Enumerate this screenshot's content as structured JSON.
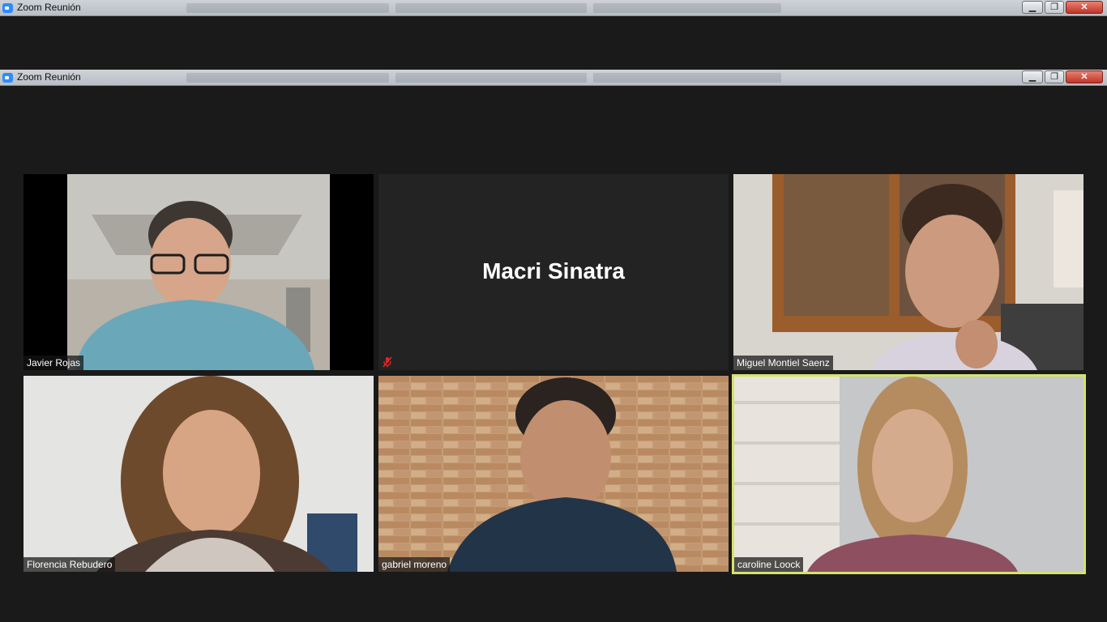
{
  "window": {
    "title": "Zoom Reunión"
  },
  "window_ghost": {
    "title": "Zoom Reunión"
  },
  "participants": [
    {
      "name": "Javier Rojas",
      "video": true
    },
    {
      "name": "Macri Sinatra",
      "video": false,
      "muted": true
    },
    {
      "name": "Miguel Montiel Saenz",
      "video": true
    },
    {
      "name": "Florencia Rebudero",
      "video": true
    },
    {
      "name": "gabriel moreno",
      "video": true
    },
    {
      "name": "caroline Loock",
      "video": true,
      "active_speaker": true
    }
  ],
  "colors": {
    "active_speaker_border": "#d4e36b",
    "background": "#1a1a1a",
    "mute_icon": "#e02828"
  },
  "icons": {
    "mute": "microphone-muted-icon",
    "app": "zoom-icon"
  }
}
